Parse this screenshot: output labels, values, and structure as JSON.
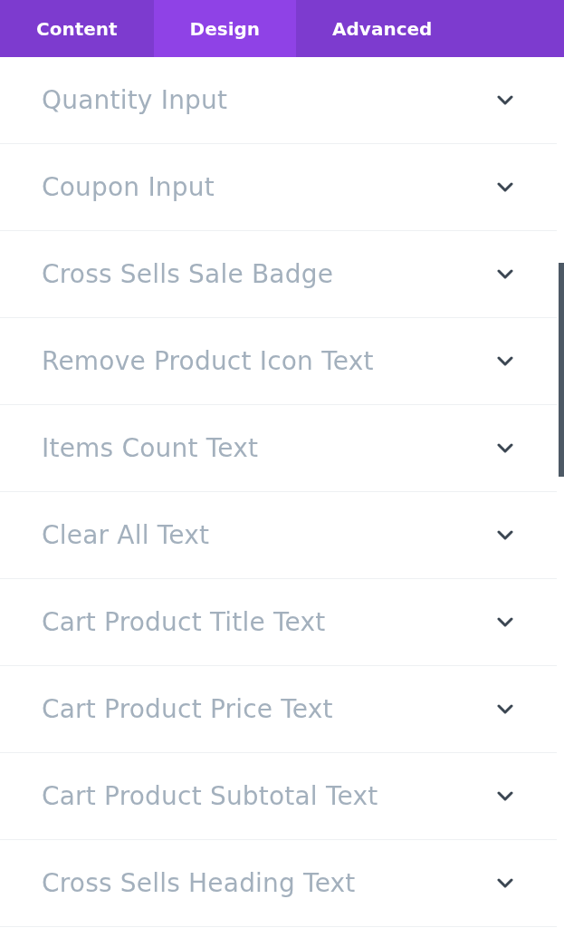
{
  "tabs": [
    {
      "label": "Content",
      "selected": false
    },
    {
      "label": "Design",
      "selected": true
    },
    {
      "label": "Advanced",
      "selected": false
    }
  ],
  "sections": [
    {
      "title": "Quantity Input",
      "expanded": false
    },
    {
      "title": "Coupon Input",
      "expanded": false
    },
    {
      "title": "Cross Sells Sale Badge",
      "expanded": false
    },
    {
      "title": "Remove Product Icon Text",
      "expanded": false
    },
    {
      "title": "Items Count Text",
      "expanded": false
    },
    {
      "title": "Clear All Text",
      "expanded": false
    },
    {
      "title": "Cart Product Title Text",
      "expanded": false
    },
    {
      "title": "Cart Product Price Text",
      "expanded": false
    },
    {
      "title": "Cart Product Subtotal Text",
      "expanded": false
    },
    {
      "title": "Cross Sells Heading Text",
      "expanded": false
    }
  ]
}
